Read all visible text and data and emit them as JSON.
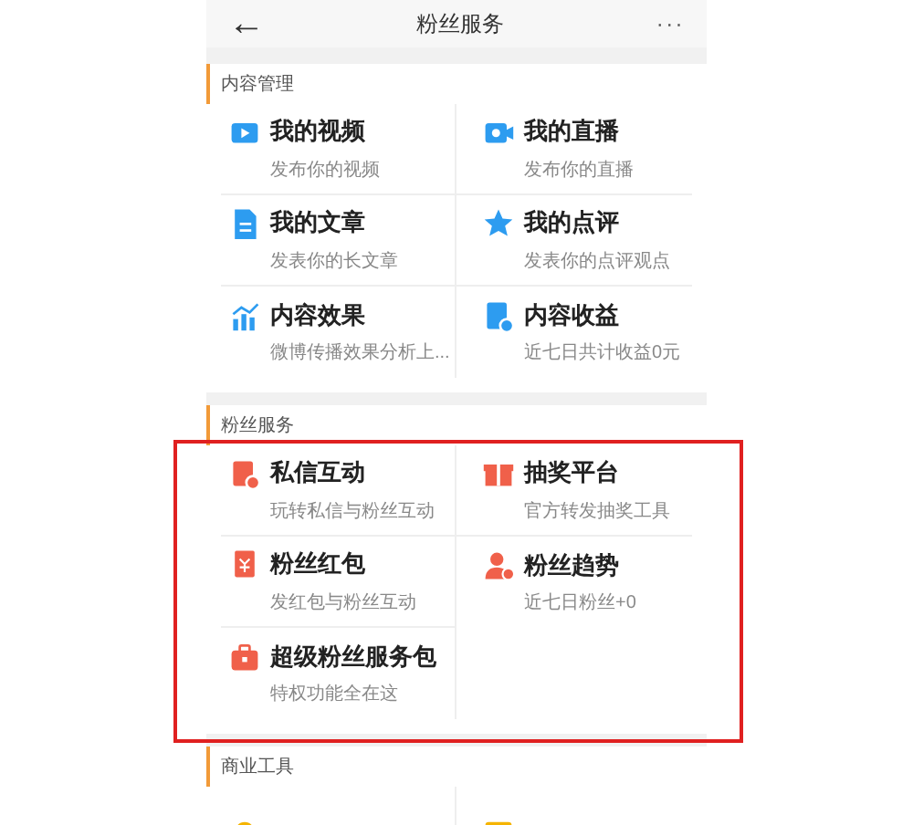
{
  "header": {
    "back": "←",
    "title": "粉丝服务",
    "more": "···"
  },
  "sections": [
    {
      "title": "内容管理",
      "items": [
        {
          "title": "我的视频",
          "subtitle": "发布你的视频"
        },
        {
          "title": "我的直播",
          "subtitle": "发布你的直播"
        },
        {
          "title": "我的文章",
          "subtitle": "发表你的长文章"
        },
        {
          "title": "我的点评",
          "subtitle": "发表你的点评观点"
        },
        {
          "title": "内容效果",
          "subtitle": "微博传播效果分析上..."
        },
        {
          "title": "内容收益",
          "subtitle": "近七日共计收益0元"
        }
      ]
    },
    {
      "title": "粉丝服务",
      "items": [
        {
          "title": "私信互动",
          "subtitle": "玩转私信与粉丝互动"
        },
        {
          "title": "抽奖平台",
          "subtitle": "官方转发抽奖工具"
        },
        {
          "title": "粉丝红包",
          "subtitle": "发红包与粉丝互动"
        },
        {
          "title": "粉丝趋势",
          "subtitle": "近七日粉丝+0"
        },
        {
          "title": "超级粉丝服务包",
          "subtitle": "特权功能全在这"
        }
      ]
    },
    {
      "title": "商业工具",
      "items": [
        {
          "kind": "partial"
        },
        {
          "kind": "partial"
        }
      ]
    }
  ]
}
